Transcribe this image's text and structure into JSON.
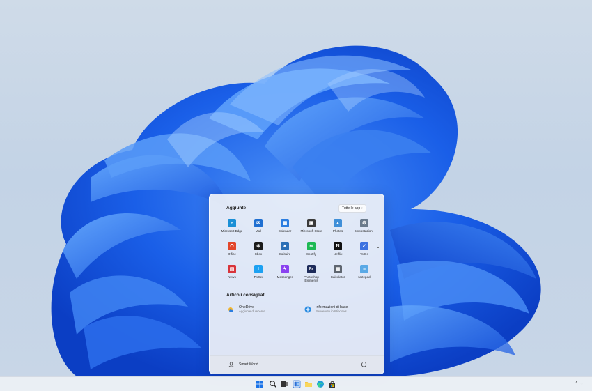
{
  "start_menu": {
    "pinned_title": "Aggiunte",
    "all_apps_label": "Tutte le app",
    "pinned_apps": [
      {
        "label": "Microsoft Edge",
        "icon": "edge-icon",
        "color": "#1a8fd6",
        "glyph": "e"
      },
      {
        "label": "Mail",
        "icon": "mail-icon",
        "color": "#1f6fd1",
        "glyph": "✉"
      },
      {
        "label": "Calendar",
        "icon": "calendar-icon",
        "color": "#2b7de0",
        "glyph": "▦"
      },
      {
        "label": "Microsoft Store",
        "icon": "store-icon",
        "color": "#3a3a3a",
        "glyph": "▣"
      },
      {
        "label": "Photos",
        "icon": "photos-icon",
        "color": "#3f8fd8",
        "glyph": "▲"
      },
      {
        "label": "Impostazioni",
        "icon": "settings-icon",
        "color": "#6b7b8c",
        "glyph": "⚙"
      },
      {
        "label": "Office",
        "icon": "office-icon",
        "color": "#e2462b",
        "glyph": "O"
      },
      {
        "label": "Xbox",
        "icon": "xbox-icon",
        "color": "#1b1b1b",
        "glyph": "⊗"
      },
      {
        "label": "Solitaire",
        "icon": "solitaire-icon",
        "color": "#2a6fb6",
        "glyph": "♠"
      },
      {
        "label": "Spotify",
        "icon": "spotify-icon",
        "color": "#1db954",
        "glyph": "≋"
      },
      {
        "label": "Netflix",
        "icon": "netflix-icon",
        "color": "#111111",
        "glyph": "N"
      },
      {
        "label": "To Do",
        "icon": "todo-icon",
        "color": "#3c72e0",
        "glyph": "✓"
      },
      {
        "label": "News",
        "icon": "news-icon",
        "color": "#d8343b",
        "glyph": "▤"
      },
      {
        "label": "Twitter",
        "icon": "twitter-icon",
        "color": "#1da1f2",
        "glyph": "t"
      },
      {
        "label": "Messenger",
        "icon": "messenger-icon",
        "color": "#8a42f0",
        "glyph": "ϟ"
      },
      {
        "label": "Photoshop Elements",
        "icon": "photoshop-elements-icon",
        "color": "#1d2b5a",
        "glyph": "Ps"
      },
      {
        "label": "Calculator",
        "icon": "calculator-icon",
        "color": "#5f6670",
        "glyph": "▦"
      },
      {
        "label": "Notepad",
        "icon": "notepad-icon",
        "color": "#5aa9e6",
        "glyph": "≡"
      }
    ],
    "recommended_title": "Articoli consigliati",
    "recommended": [
      {
        "name": "OneDrive",
        "sub": "Aggiunte di recente",
        "icon": "onedrive-icon"
      },
      {
        "name": "Informazioni di base",
        "sub": "Benvenuto in Windows",
        "icon": "tips-icon"
      }
    ],
    "user_name": "Smart World"
  },
  "taskbar": {
    "icons": [
      "start-icon",
      "search-icon",
      "task-view-icon",
      "widgets-icon",
      "file-explorer-icon",
      "edge-icon",
      "store-icon"
    ],
    "tray_icons": [
      "chevron-up-icon",
      "wifi-icon"
    ]
  }
}
